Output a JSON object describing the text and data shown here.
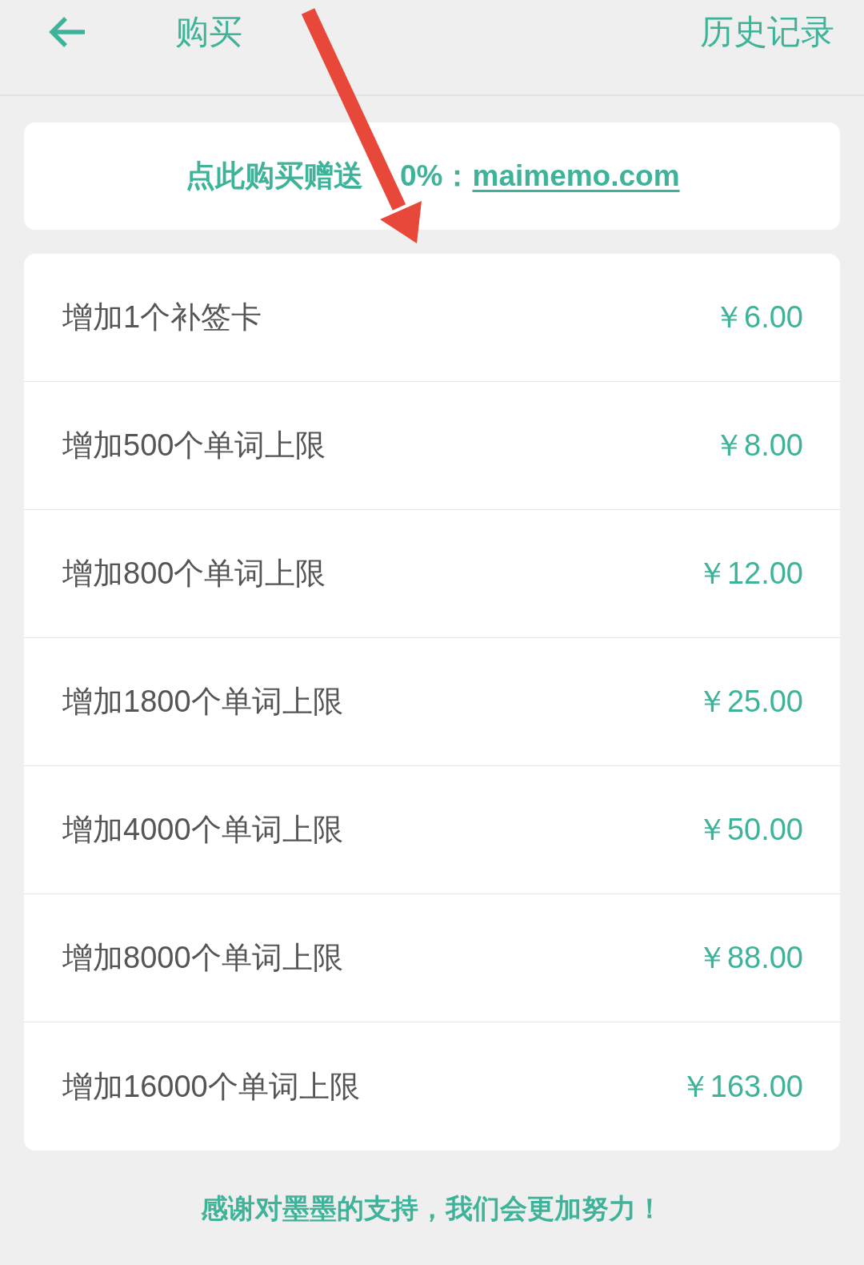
{
  "header": {
    "title": "购买",
    "history_link": "历史记录"
  },
  "promo": {
    "text_before": "点此购买赠送",
    "text_after": "0%：",
    "link": "maimemo.com"
  },
  "products": [
    {
      "name": "增加1个补签卡",
      "price": "￥6.00"
    },
    {
      "name": "增加500个单词上限",
      "price": "￥8.00"
    },
    {
      "name": "增加800个单词上限",
      "price": "￥12.00"
    },
    {
      "name": "增加1800个单词上限",
      "price": "￥25.00"
    },
    {
      "name": "增加4000个单词上限",
      "price": "￥50.00"
    },
    {
      "name": "增加8000个单词上限",
      "price": "￥88.00"
    },
    {
      "name": "增加16000个单词上限",
      "price": "￥163.00"
    }
  ],
  "footer": {
    "text": "感谢对墨墨的支持，我们会更加努力！"
  }
}
